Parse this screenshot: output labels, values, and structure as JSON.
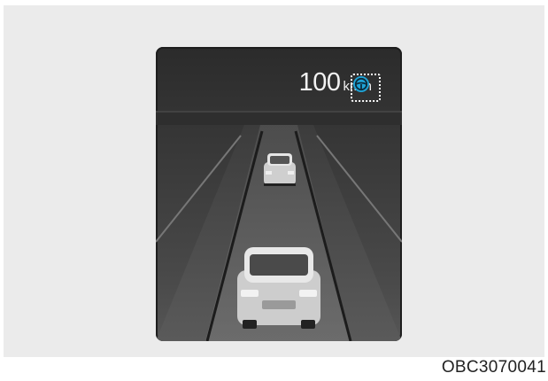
{
  "display": {
    "speed_value": "100",
    "speed_unit": "km/h",
    "indicator_icon": "steering-wheel-icon",
    "indicator_color": "#1fa3d6"
  },
  "figure": {
    "code": "OBC3070041"
  }
}
